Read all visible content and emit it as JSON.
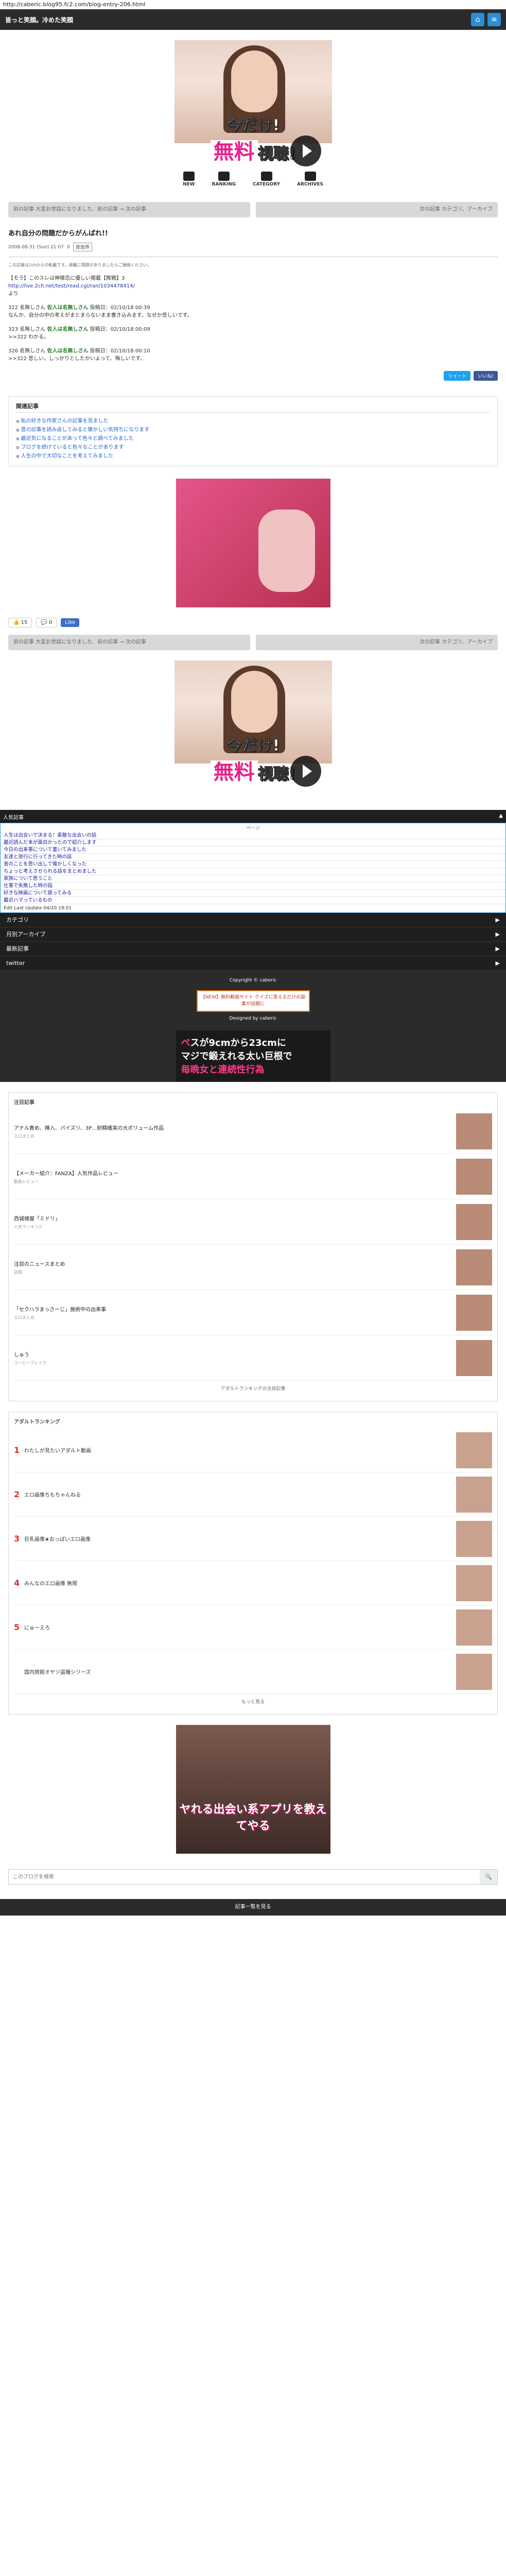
{
  "url": "http://caberic.blog95.fc2.com/blog-entry-206.html",
  "header": {
    "title": "皆っと笑顔。冷めた笑顔"
  },
  "banner": {
    "headline_a": "今だけ!",
    "headline_b": "無料",
    "headline_c": "視聴!",
    "icons": [
      "NEW",
      "RANKING",
      "CATEGORY",
      "ARCHIVES"
    ]
  },
  "nav": {
    "prev": "前の記事 大変お世話になりました、前の記事 → 次の記事",
    "next": "次の記事 カテゴリ、アーカイブ"
  },
  "article": {
    "title": "あれ自分の問題だからがんばれ!!",
    "date": "2008-08-31 (Sun) 21:07",
    "comments": "0",
    "tag": "寄席界",
    "intro": "この記事は2chからの転載です。掲載に問題がありましたらご連絡ください。",
    "posts": [
      {
        "header": "【モラ】このスレは神様恋に優しい掲載【敗戦】3",
        "link": "http://live.2ch.net/test/read.cgi/ran/1034478414/",
        "body": "より"
      },
      {
        "num": "322",
        "name": "名無しさん",
        "handle": "佐人は名無しさん",
        "date": "投稿日：02/10/18 00:39",
        "body": "なんか、自分の中の考えがまとまらないまま書き込みます。なぜか悲しいです。"
      },
      {
        "num": "323",
        "name": "名無しさん",
        "handle": "佐人は名無しさん",
        "date": "投稿日：02/10/18 00:09",
        "body": ">>322 わかる。"
      },
      {
        "num": "326",
        "name": "名無しさん",
        "handle": "佐人は名無しさん",
        "date": "投稿日：02/10/18 00:10",
        "body": ">>322 悲しい。しっかりとしたかいよって、悔しいです。"
      }
    ]
  },
  "share": {
    "twitter": "ツイート",
    "facebook": "いいね!"
  },
  "related": {
    "title": "関連記事",
    "items": [
      "私の好きな作家さんの記事を見ました",
      "昔の記事を読み返してみると懐かしい気持ちになります",
      "最近気になることがあって色々と調べてみました",
      "ブログを続けていると色々なことがあります",
      "人生の中で大切なことを考えてみました"
    ]
  },
  "likes": {
    "count1": "15",
    "count2": "0",
    "fb": "Like"
  },
  "rank": {
    "title": "人気記事",
    "page": "ページ",
    "items": [
      "人生は出会いで決まる！素敵な出会いの話",
      "最近読んだ本が面白かったので紹介します",
      "今日の出来事について書いてみました",
      "友達と旅行に行ってきた時の話",
      "昔のことを思い出して懐かしくなった",
      "ちょっと考えさせられる話をまとめました",
      "家族について思うこと",
      "仕事で失敗した時の話",
      "好きな映画について語ってみる",
      "最近ハマっているもの"
    ],
    "footer": "Edit Last Update 04/20 19:01"
  },
  "menu": [
    "カテゴリ",
    "月別アーカイブ",
    "最新記事",
    "twitter"
  ],
  "footer": {
    "copyright": "Copyright © caberic",
    "designed": "Designed by caberic",
    "ad1": "【NEW】無料動画サイト クイズに答えるだけの副業が話題に",
    "ad2_a": "ぺ",
    "ad2_b": "ス",
    "ad2_c": "が9cmから23cmに",
    "ad2_d": "マジで鍛えれる太い巨根で",
    "ad2_e": "毎晩女と連続性行為"
  },
  "section1": {
    "title": "注目記事",
    "items": [
      {
        "t": "アナル責め、挿入、パイズリ、3P…射精確実の大ボリューム作品",
        "s": "エロまとめ"
      },
      {
        "t": "【メーカー紹介：FANZA】人気作品レビュー",
        "s": "動画レビュー"
      },
      {
        "t": "西城様屋「ミドリ」",
        "s": "人気ランキング"
      },
      {
        "t": "注目のニュースまとめ",
        "s": "話題"
      },
      {
        "t": "「セクハラまっさーじ」施術中の出来事",
        "s": "エロまとめ"
      },
      {
        "t": "しゅう",
        "s": "コーヒーブレイク"
      }
    ],
    "more": "アダルトランキングの注目記事"
  },
  "section2": {
    "title": "アダルトランキング",
    "items": [
      "わたしが見たいアダルト動画",
      "エロ画像ちもちゃんねる",
      "巨乳画像★おっぱいエロ画像",
      "みんなのエロ画像 無限",
      "にゅーえろ",
      "国内旅館オヤジ盗撮シリーズ"
    ],
    "more": "もっと見る"
  },
  "bigad": {
    "text": "ヤれる出会い系アプリを教えてやる"
  },
  "search": {
    "placeholder": "このブログを検索"
  },
  "bottom": {
    "label": "記事一覧を見る"
  }
}
